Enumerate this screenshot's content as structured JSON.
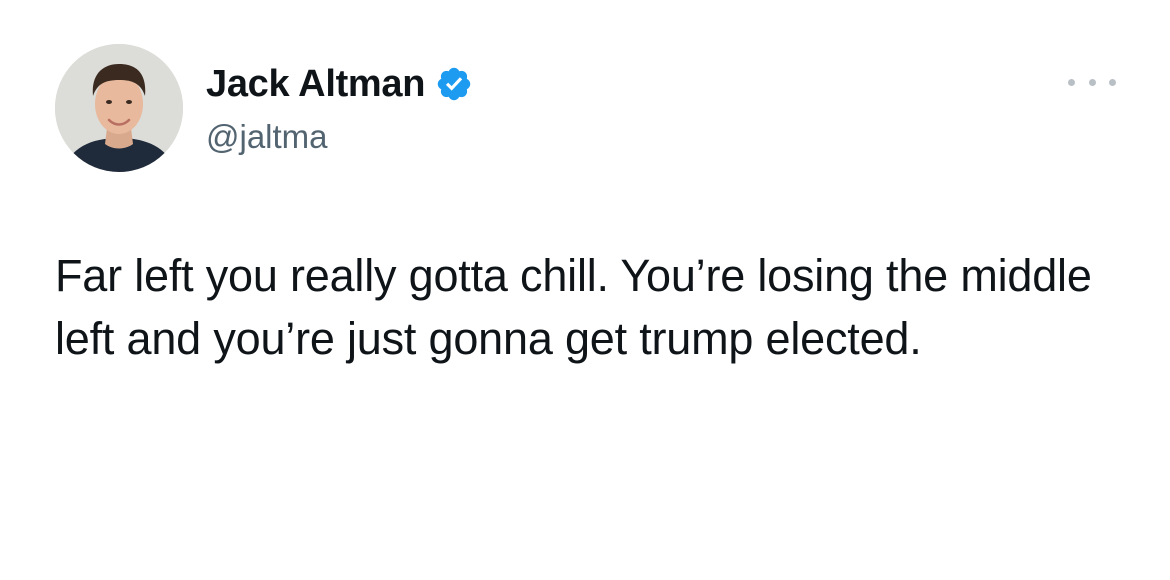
{
  "tweet": {
    "author": {
      "display_name": "Jack Altman",
      "handle": "@jaltma",
      "verified": true,
      "verified_badge_icon": "verified-check-icon",
      "verified_color": "#1d9bf0"
    },
    "menu_icon": "more-options-icon",
    "text": "Far left you really gotta chill. You’re losing the middle left and you’re just gonna get trump elected."
  }
}
